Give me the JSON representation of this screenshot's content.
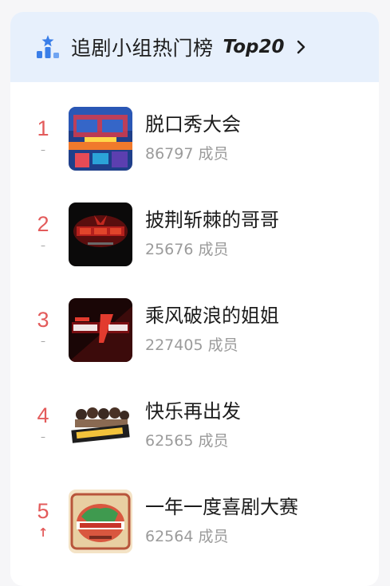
{
  "header": {
    "title": "追剧小组热门榜",
    "badge": "Top20",
    "icon": "bar-chart-star-icon",
    "chevron_icon": "chevron-right-icon"
  },
  "colors": {
    "header_bg": "#e7f0fc",
    "rank_red": "#e35b5b",
    "meta_gray": "#9b9b9b",
    "icon_blue": "#3a7ee8"
  },
  "items": [
    {
      "rank": "1",
      "trend": "–",
      "name": "脱口秀大会",
      "members": "86797 成员"
    },
    {
      "rank": "2",
      "trend": "–",
      "name": "披荆斩棘的哥哥",
      "members": "25676 成员"
    },
    {
      "rank": "3",
      "trend": "–",
      "name": "乘风破浪的姐姐",
      "members": "227405 成员"
    },
    {
      "rank": "4",
      "trend": "–",
      "name": "快乐再出发",
      "members": "62565 成员"
    },
    {
      "rank": "5",
      "trend": "↑",
      "name": "一年一度喜剧大赛",
      "members": "62564 成员"
    }
  ]
}
